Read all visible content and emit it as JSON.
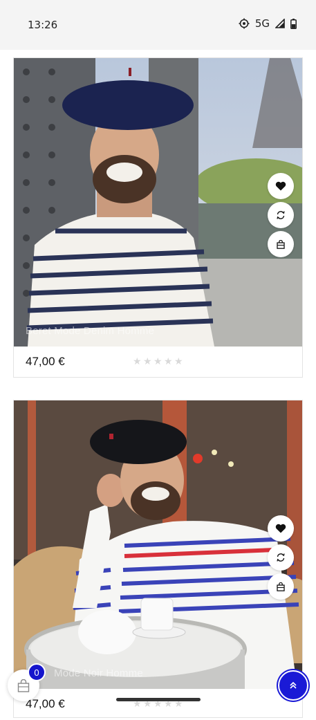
{
  "status_bar": {
    "time": "13:26",
    "network": "5G",
    "icons": [
      "location-target-icon",
      "signal-icon",
      "battery-icon"
    ]
  },
  "products": [
    {
      "caption": "Beret Mode Denim Homme",
      "price": "47,00 €",
      "rating": 0,
      "max_rating": 5,
      "actions": [
        "heart-icon",
        "refresh-compare-icon",
        "shopping-bag-icon"
      ]
    },
    {
      "caption": "Mode Noir Homme",
      "price": "47,00 €",
      "rating": 0,
      "max_rating": 5,
      "actions": [
        "heart-icon",
        "refresh-compare-icon",
        "shopping-bag-icon"
      ]
    }
  ],
  "cart": {
    "count": "0"
  },
  "colors": {
    "accent": "#1a1ad6",
    "star_empty": "#d9d9d9",
    "status_bg": "#f4f4f4"
  }
}
